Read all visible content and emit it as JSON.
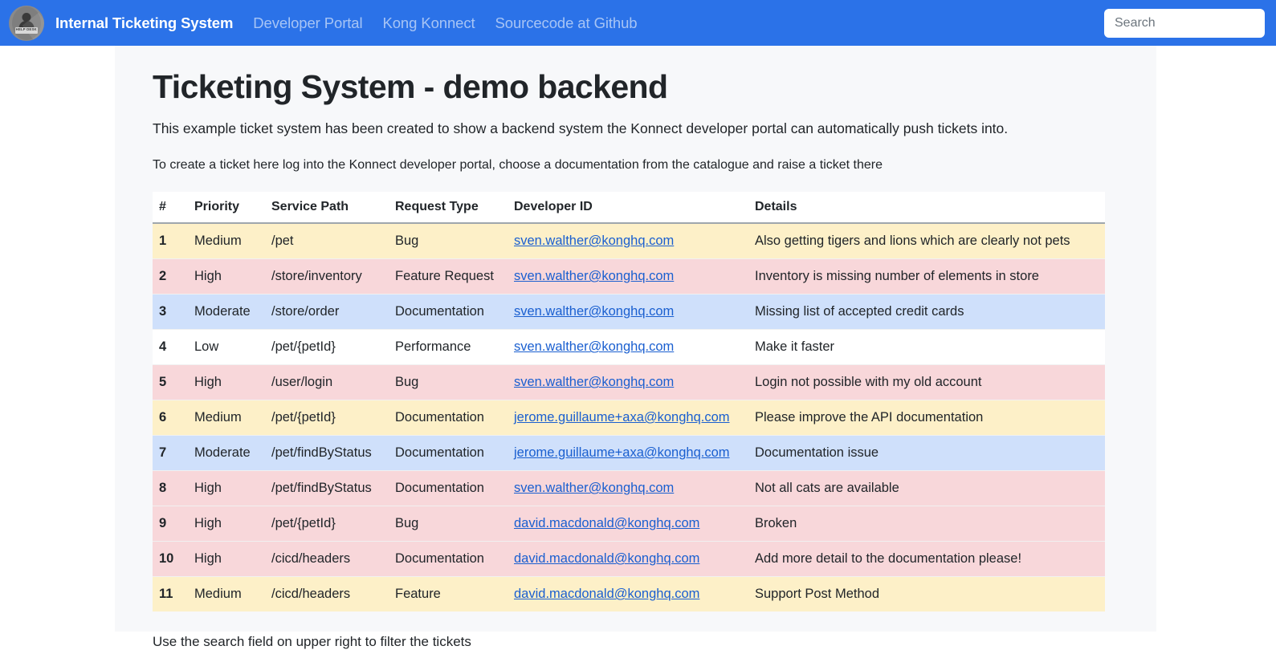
{
  "navbar": {
    "logo": {
      "icon": "help-desk-avatar-icon",
      "plate_text": "HELP DESK"
    },
    "brand": "Internal Ticketing System",
    "links": [
      {
        "label": "Developer Portal"
      },
      {
        "label": "Kong Konnect"
      },
      {
        "label": "Sourcecode at Github"
      }
    ],
    "search": {
      "placeholder": "Search",
      "value": ""
    },
    "background_color": "#2b72e8"
  },
  "main": {
    "title": "Ticketing System - demo backend",
    "lead": "This example ticket system has been created to show a backend system the Konnect developer portal can automatically push tickets into.",
    "sub": "To create a ticket here log into the Konnect developer portal, choose a documentation from the catalogue and raise a ticket there",
    "footnote": "Use the search field on upper right to filter the tickets"
  },
  "table": {
    "columns": [
      "#",
      "Priority",
      "Service Path",
      "Request Type",
      "Developer ID",
      "Details"
    ],
    "row_colors": {
      "warning": "#fdf0c8",
      "danger": "#f8d7da",
      "info": "#cfe0fb",
      "plain": "#ffffff"
    },
    "rows": [
      {
        "id": "1",
        "priority": "Medium",
        "path": "/pet",
        "type": "Bug",
        "dev": "sven.walther@konghq.com",
        "details": "Also getting tigers and lions which are clearly not pets",
        "style": "warning"
      },
      {
        "id": "2",
        "priority": "High",
        "path": "/store/inventory",
        "type": "Feature Request",
        "dev": "sven.walther@konghq.com",
        "details": "Inventory is missing number of elements in store",
        "style": "danger"
      },
      {
        "id": "3",
        "priority": "Moderate",
        "path": "/store/order",
        "type": "Documentation",
        "dev": "sven.walther@konghq.com",
        "details": "Missing list of accepted credit cards",
        "style": "info"
      },
      {
        "id": "4",
        "priority": "Low",
        "path": "/pet/{petId}",
        "type": "Performance",
        "dev": "sven.walther@konghq.com",
        "details": "Make it faster",
        "style": "plain"
      },
      {
        "id": "5",
        "priority": "High",
        "path": "/user/login",
        "type": "Bug",
        "dev": "sven.walther@konghq.com",
        "details": "Login not possible with my old account",
        "style": "danger"
      },
      {
        "id": "6",
        "priority": "Medium",
        "path": "/pet/{petId}",
        "type": "Documentation",
        "dev": "jerome.guillaume+axa@konghq.com",
        "details": "Please improve the API documentation",
        "style": "warning"
      },
      {
        "id": "7",
        "priority": "Moderate",
        "path": "/pet/findByStatus",
        "type": "Documentation",
        "dev": "jerome.guillaume+axa@konghq.com",
        "details": "Documentation issue",
        "style": "info"
      },
      {
        "id": "8",
        "priority": "High",
        "path": "/pet/findByStatus",
        "type": "Documentation",
        "dev": "sven.walther@konghq.com",
        "details": "Not all cats are available",
        "style": "danger"
      },
      {
        "id": "9",
        "priority": "High",
        "path": "/pet/{petId}",
        "type": "Bug",
        "dev": "david.macdonald@konghq.com",
        "details": "Broken",
        "style": "danger"
      },
      {
        "id": "10",
        "priority": "High",
        "path": "/cicd/headers",
        "type": "Documentation",
        "dev": "david.macdonald@konghq.com",
        "details": "Add more detail to the documentation please!",
        "style": "danger"
      },
      {
        "id": "11",
        "priority": "Medium",
        "path": "/cicd/headers",
        "type": "Feature",
        "dev": "david.macdonald@konghq.com",
        "details": "Support Post Method",
        "style": "warning"
      }
    ]
  }
}
